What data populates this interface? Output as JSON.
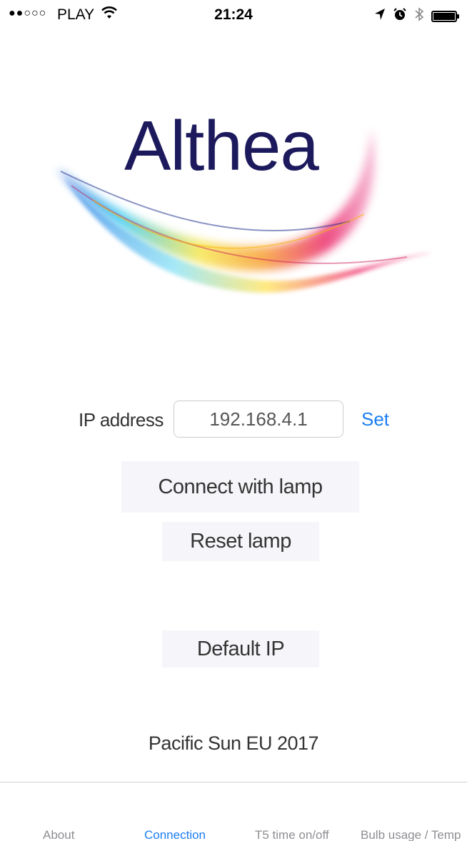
{
  "status_bar": {
    "signal": "●●○○○",
    "carrier": "PLAY",
    "time": "21:24",
    "icons": [
      "wifi-icon",
      "location-arrow-icon",
      "alarm-icon",
      "bluetooth-icon",
      "battery-icon"
    ]
  },
  "logo": {
    "title": "Althea"
  },
  "connection": {
    "ip_label": "IP address",
    "ip_value": "192.168.4.1",
    "set_label": "Set",
    "connect_button": "Connect with lamp",
    "reset_button": "Reset lamp",
    "default_ip_button": "Default IP"
  },
  "footer": {
    "text": "Pacific Sun EU 2017"
  },
  "tabs": [
    {
      "label": "About",
      "active": false
    },
    {
      "label": "Connection",
      "active": true
    },
    {
      "label": "T5 time on/off",
      "active": false
    },
    {
      "label": "Bulb usage / Temp",
      "active": false
    }
  ],
  "colors": {
    "accent": "#1a7ef2",
    "logo_text": "#1c1a5c",
    "button_bg": "#f6f6fa"
  }
}
